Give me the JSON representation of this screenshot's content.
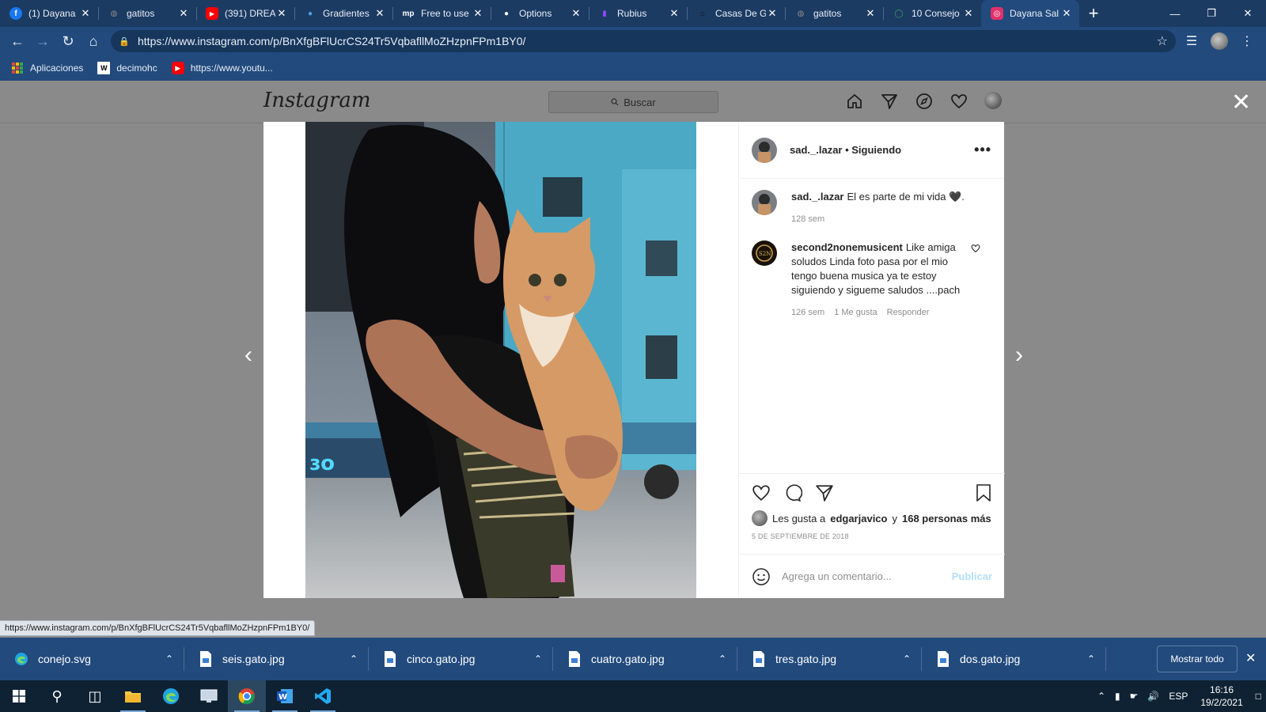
{
  "browser": {
    "tabs": [
      {
        "title": "(1) Dayana",
        "favicon": "facebook-icon",
        "color": "#1877f2"
      },
      {
        "title": "gatitos",
        "favicon": "globe-icon",
        "color": "#8a8a8a"
      },
      {
        "title": "(391) DREA",
        "favicon": "youtube-icon",
        "color": "#ff0000"
      },
      {
        "title": "Gradientes",
        "favicon": "gradient-icon",
        "color": "#4fa3e8"
      },
      {
        "title": "Free to use",
        "favicon": "mp-icon",
        "color": "#ffffff"
      },
      {
        "title": "Options",
        "favicon": "github-icon",
        "color": "#ffffff"
      },
      {
        "title": "Rubius",
        "favicon": "twitch-icon",
        "color": "#9146ff"
      },
      {
        "title": "Casas De G",
        "favicon": "house-icon",
        "color": "#111111"
      },
      {
        "title": "gatitos",
        "favicon": "globe-icon",
        "color": "#8a8a8a"
      },
      {
        "title": "10 Consejo",
        "favicon": "ring-icon",
        "color": "#34a853"
      },
      {
        "title": "Dayana Sal",
        "favicon": "instagram-icon",
        "color": "#e1306c",
        "active": true
      }
    ],
    "url": "https://www.instagram.com/p/BnXfgBFlUcrCS24Tr5VqbafllMoZHzpnFPm1BY0/",
    "bookmarks": [
      {
        "label": "Aplicaciones",
        "icon": "apps-grid-icon"
      },
      {
        "label": "decimohc",
        "icon": "wix-icon"
      },
      {
        "label": "https://www.youtu...",
        "icon": "youtube-icon"
      }
    ],
    "status_url": "https://www.instagram.com/p/BnXfgBFlUcrCS24Tr5VqbafllMoZHzpnFPm1BY0/"
  },
  "instagram": {
    "logo": "Instagram",
    "search_placeholder": "Buscar",
    "post": {
      "author": "sad._.lazar",
      "follow_state": "Siguiendo",
      "header_text": "sad._.lazar • Siguiendo",
      "caption": {
        "user": "sad._.lazar",
        "text": "El es parte de mi vida 🖤.",
        "age": "128 sem"
      },
      "comments": [
        {
          "user": "second2nonemusicent",
          "text": "Like amiga soludos Linda foto  pasa por el mio tengo buena musica ya te estoy siguiendo y sigueme saludos ....pach",
          "age": "126 sem",
          "likes": "1 Me gusta",
          "reply": "Responder"
        }
      ],
      "likes_prefix": "Les gusta a",
      "likes_user": "edgarjavico",
      "likes_joiner": "y",
      "likes_others": "168 personas más",
      "date": "5 de septiembre de 2018",
      "comment_placeholder": "Agrega un comentario...",
      "publish": "Publicar"
    }
  },
  "downloads": {
    "items": [
      "conejo.svg",
      "seis.gato.jpg",
      "cinco.gato.jpg",
      "cuatro.gato.jpg",
      "tres.gato.jpg",
      "dos.gato.jpg"
    ],
    "show_all": "Mostrar todo"
  },
  "taskbar": {
    "lang": "ESP",
    "time": "16:16",
    "date": "19/2/2021"
  },
  "colors": {
    "chrome_dark": "#1c3b63",
    "chrome": "#224a7d",
    "overlay": "#8a8a8a",
    "publish": "#b2dffc"
  }
}
